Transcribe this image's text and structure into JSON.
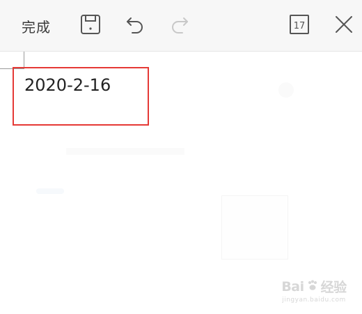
{
  "toolbar": {
    "done_label": "完成",
    "save_icon": "save-icon",
    "undo_icon": "undo-icon",
    "redo_icon": "redo-icon",
    "calendar_icon": "calendar-icon",
    "calendar_day": "17",
    "close_icon": "close-icon",
    "redo_disabled": true
  },
  "canvas": {
    "date_text": "2020-2-16",
    "highlight_color": "#e53935"
  },
  "watermark": {
    "logo_text": "Bai",
    "logo_text_2": "经验",
    "sub_text": "jingyan.baidu.com"
  },
  "colors": {
    "toolbar_bg": "#f7f7f7",
    "icon": "#555555",
    "icon_disabled": "#c8c8c8",
    "highlight": "#e53935"
  }
}
